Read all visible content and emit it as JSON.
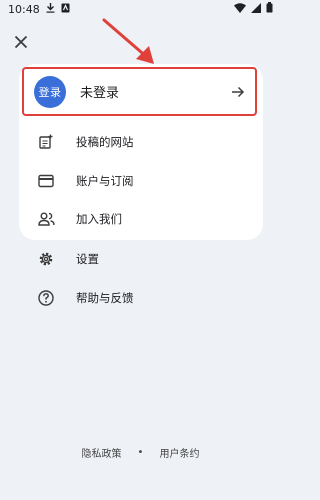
{
  "status_bar": {
    "time": "10:48"
  },
  "login": {
    "avatar_text": "登录",
    "label": "未登录"
  },
  "menu": {
    "items": [
      {
        "label": "投稿的网站",
        "icon": "post-add-icon"
      },
      {
        "label": "账户与订阅",
        "icon": "credit-card-icon"
      },
      {
        "label": "加入我们",
        "icon": "people-icon"
      },
      {
        "label": "设置",
        "icon": "gear-icon"
      },
      {
        "label": "帮助与反馈",
        "icon": "help-icon"
      }
    ]
  },
  "footer": {
    "privacy": "隐私政策",
    "separator": "•",
    "terms": "用户条约"
  },
  "colors": {
    "accent": "#3a6fd9",
    "highlight_border": "#e0403a",
    "background": "#eef1f6"
  }
}
